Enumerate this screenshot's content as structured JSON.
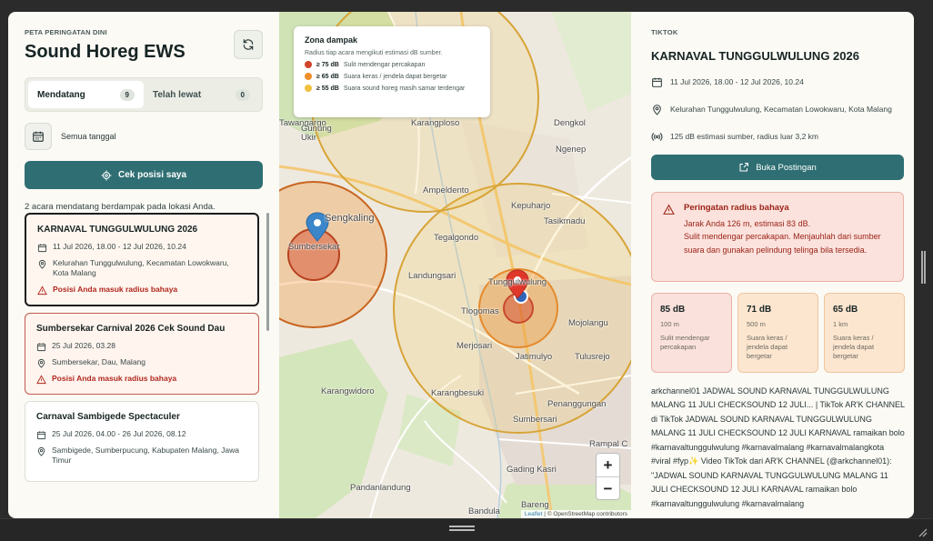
{
  "app": {
    "eyebrow": "PETA PERINGATAN DINI",
    "title": "Sound Horeg EWS"
  },
  "tabs": [
    {
      "label": "Mendatang",
      "count": "9",
      "active": true
    },
    {
      "label": "Telah lewat",
      "count": "0",
      "active": false
    }
  ],
  "date_filter": {
    "label": "Semua tanggal"
  },
  "locate_button": {
    "label": "Cek posisi saya"
  },
  "summary": "2 acara mendatang berdampak pada lokasi Anda.",
  "events": [
    {
      "title": "KARNAVAL TUNGGULWULUNG 2026",
      "date": "11 Jul 2026, 18.00 - 12 Jul 2026, 10.24",
      "location": "Kelurahan Tunggulwulung, Kecamatan Lowokwaru, Kota Malang",
      "alert": "Posisi Anda masuk radius bahaya"
    },
    {
      "title": "Sumbersekar Carnival 2026 Cek Sound Dau",
      "date": "25 Jul 2026, 03.28",
      "location": "Sumbersekar, Dau, Malang",
      "alert": "Posisi Anda masuk radius bahaya"
    },
    {
      "title": "Carnaval Sambigede Spectaculer",
      "date": "25 Jul 2026, 04.00 - 26 Jul 2026, 08.12",
      "location": "Sambigede, Sumberpucung, Kabupaten Malang, Jawa Timur",
      "alert": ""
    }
  ],
  "legend": {
    "title": "Zona dampak",
    "subtitle": "Radius tiap acara mengikuti estimasi dB sumber.",
    "items": [
      {
        "level": "≥ 75 dB",
        "text": "Sulit mendengar percakapan",
        "color": "#d2452c"
      },
      {
        "level": "≥ 65 dB",
        "text": "Suara keras / jendela dapat bergetar",
        "color": "#ee8f2b"
      },
      {
        "level": "≥ 55 dB",
        "text": "Suara sound horeg masih samar terdengar",
        "color": "#f2c03e"
      }
    ]
  },
  "map_labels": [
    {
      "name": "karangploso",
      "text": "Karangploso"
    },
    {
      "name": "dengkol",
      "text": "Dengkol"
    },
    {
      "name": "tawangargo",
      "text": "Tawangargo"
    },
    {
      "name": "gunung-ukir",
      "text": "Gunung Ukir"
    },
    {
      "name": "ngenep",
      "text": "Ngenep"
    },
    {
      "name": "ampeldento",
      "text": "Ampeldento"
    },
    {
      "name": "kepuharjo",
      "text": "Kepuharjo"
    },
    {
      "name": "tasikmadu",
      "text": "Tasikmadu"
    },
    {
      "name": "sengkaling",
      "text": "Sengkaling"
    },
    {
      "name": "sumbersekar",
      "text": "Sumbersekar"
    },
    {
      "name": "tegalgondo",
      "text": "Tegalgondo"
    },
    {
      "name": "landungsari",
      "text": "Landungsari"
    },
    {
      "name": "tunggulwulung",
      "text": "Tunggulwulung"
    },
    {
      "name": "tlogomas",
      "text": "Tlogomas"
    },
    {
      "name": "mojolangu",
      "text": "Mojolangu"
    },
    {
      "name": "merjosari",
      "text": "Merjosari"
    },
    {
      "name": "jatimulyo",
      "text": "Jatimulyo"
    },
    {
      "name": "tulusrejo",
      "text": "Tulusrejo"
    },
    {
      "name": "karangwidoro",
      "text": "Karangwidoro"
    },
    {
      "name": "karangbesuki",
      "text": "Karangbesuki"
    },
    {
      "name": "penanggungan",
      "text": "Penanggungan"
    },
    {
      "name": "sumbersari",
      "text": "Sumbersari"
    },
    {
      "name": "gading-kasri",
      "text": "Gading Kasri"
    },
    {
      "name": "rampal",
      "text": "Rampal C"
    },
    {
      "name": "pandanlandung",
      "text": "Pandanlandung"
    },
    {
      "name": "bareng",
      "text": "Bareng"
    },
    {
      "name": "bandulan",
      "text": "Bandula"
    }
  ],
  "map_controls": {
    "zoom_in": "+",
    "zoom_out": "−"
  },
  "attribution": {
    "leaflet": "Leaflet",
    "rest": "| © OpenStreetMap contributors"
  },
  "detail": {
    "source": "TIKTOK",
    "title": "KARNAVAL TUNGGULWULUNG 2026",
    "date": "11 Jul 2026, 18.00 - 12 Jul 2026, 10.24",
    "location": "Kelurahan Tunggulwulung, Kecamatan Lowokwaru, Kota Malang",
    "estimate": "125 dB estimasi sumber, radius luar 3,2 km",
    "open_button": "Buka Postingan",
    "warning": {
      "title": "Peringatan radius bahaya",
      "line1": "Jarak Anda 126 m, estimasi 83 dB.",
      "line2": "Sulit mendengar percakapan. Menjauhlah dari sumber suara dan gunakan pelindung telinga bila tersedia."
    },
    "levels": [
      {
        "db": "85 dB",
        "radius": "100 m",
        "desc": "Sulit mendengar percakapan"
      },
      {
        "db": "71 dB",
        "radius": "500 m",
        "desc": "Suara keras / jendela dapat bergetar"
      },
      {
        "db": "65 dB",
        "radius": "1 km",
        "desc": "Suara keras / jendela dapat bergetar"
      }
    ],
    "description": "arkchannel01 JADWAL SOUND KARNAVAL TUNGGULWULUNG MALANG 11 JULI CHECKSOUND 12 JULI... | TikTok AR'K CHANNEL di TikTok JADWAL SOUND KARNAVAL TUNGGULWULUNG MALANG 11 JULI CHECKSOUND 12 JULI KARNAVAL ramaikan bolo #karnavaltunggulwulung #karnavalmalang #karnavalmalangkota #viral #fyp✨ Video TikTok dari AR'K CHANNEL (@arkchannel01): \"JADWAL SOUND KARNAVAL TUNGGULWULUNG MALANG 11 JULI CHECKSOUND 12 JULI KARNAVAL ramaikan bolo #karnavaltunggulwulung #karnavalmalang"
  }
}
